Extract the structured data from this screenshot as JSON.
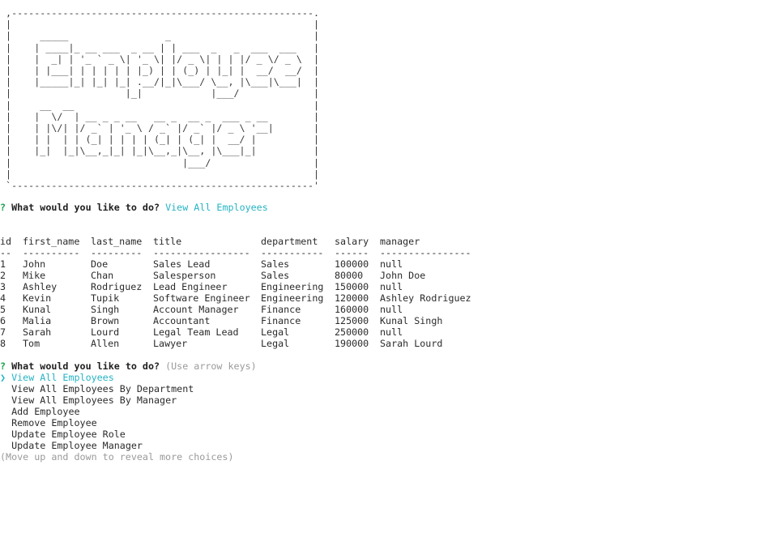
{
  "banner": {
    "art": " ,-----------------------------------------------------.\n |                                                     |\n |     _____                 _                         |\n |    | ____|_ __ ___  _ __ | | ___  _   _  ___  ___   |\n |    |  _| | '_ ` _ \\| '_ \\| |/ _ \\| | | |/ _ \\/ _ \\  |\n |    | |___| | | | | | |_) | | (_) | |_| |  __/  __/  |\n |    |_____|_| |_| |_| .__/|_|\\___/ \\__, |\\___|\\___|  |\n |                    |_|            |___/             |\n |     __  __                                          |\n |    |  \\/  | __ _ _ __   __ _  __ _  ___ _ __        |\n |    | |\\/| |/ _` | '_ \\ / _` |/ _` |/ _ \\ '__|       |\n |    | |  | | (_| | | | | (_| | (_| |  __/ |          |\n |    |_|  |_|\\__,_|_| |_|\\__,_|\\__, |\\___|_|          |\n |                              |___/                  |\n |                                                     |\n `-----------------------------------------------------'"
  },
  "prompt1": {
    "mark": "?",
    "question": "What would you like to do?",
    "answer": "View All Employees"
  },
  "table": {
    "headers": [
      "id",
      "first_name",
      "last_name",
      "title",
      "department",
      "salary",
      "manager"
    ],
    "separators": [
      "--",
      "----------",
      "---------",
      "-----------------",
      "-----------",
      "------",
      "----------------"
    ],
    "rows": [
      [
        "1",
        "John",
        "Doe",
        "Sales Lead",
        "Sales",
        "100000",
        "null"
      ],
      [
        "2",
        "Mike",
        "Chan",
        "Salesperson",
        "Sales",
        "80000",
        "John Doe"
      ],
      [
        "3",
        "Ashley",
        "Rodriguez",
        "Lead Engineer",
        "Engineering",
        "150000",
        "null"
      ],
      [
        "4",
        "Kevin",
        "Tupik",
        "Software Engineer",
        "Engineering",
        "120000",
        "Ashley Rodriguez"
      ],
      [
        "5",
        "Kunal",
        "Singh",
        "Account Manager",
        "Finance",
        "160000",
        "null"
      ],
      [
        "6",
        "Malia",
        "Brown",
        "Accountant",
        "Finance",
        "125000",
        "Kunal Singh"
      ],
      [
        "7",
        "Sarah",
        "Lourd",
        "Legal Team Lead",
        "Legal",
        "250000",
        "null"
      ],
      [
        "8",
        "Tom",
        "Allen",
        "Lawyer",
        "Legal",
        "190000",
        "Sarah Lourd"
      ]
    ]
  },
  "prompt2": {
    "mark": "?",
    "question": "What would you like to do?",
    "hint": "(Use arrow keys)",
    "pointer": "❯",
    "choices": [
      "View All Employees",
      "View All Employees By Department",
      "View All Employees By Manager",
      "Add Employee",
      "Remove Employee",
      "Update Employee Role",
      "Update Employee Manager"
    ],
    "footer": "(Move up and down to reveal more choices)"
  },
  "colors": {
    "accent": "#26b3c4",
    "question_mark": "#1aa34a",
    "hint": "#9a9a9a"
  }
}
